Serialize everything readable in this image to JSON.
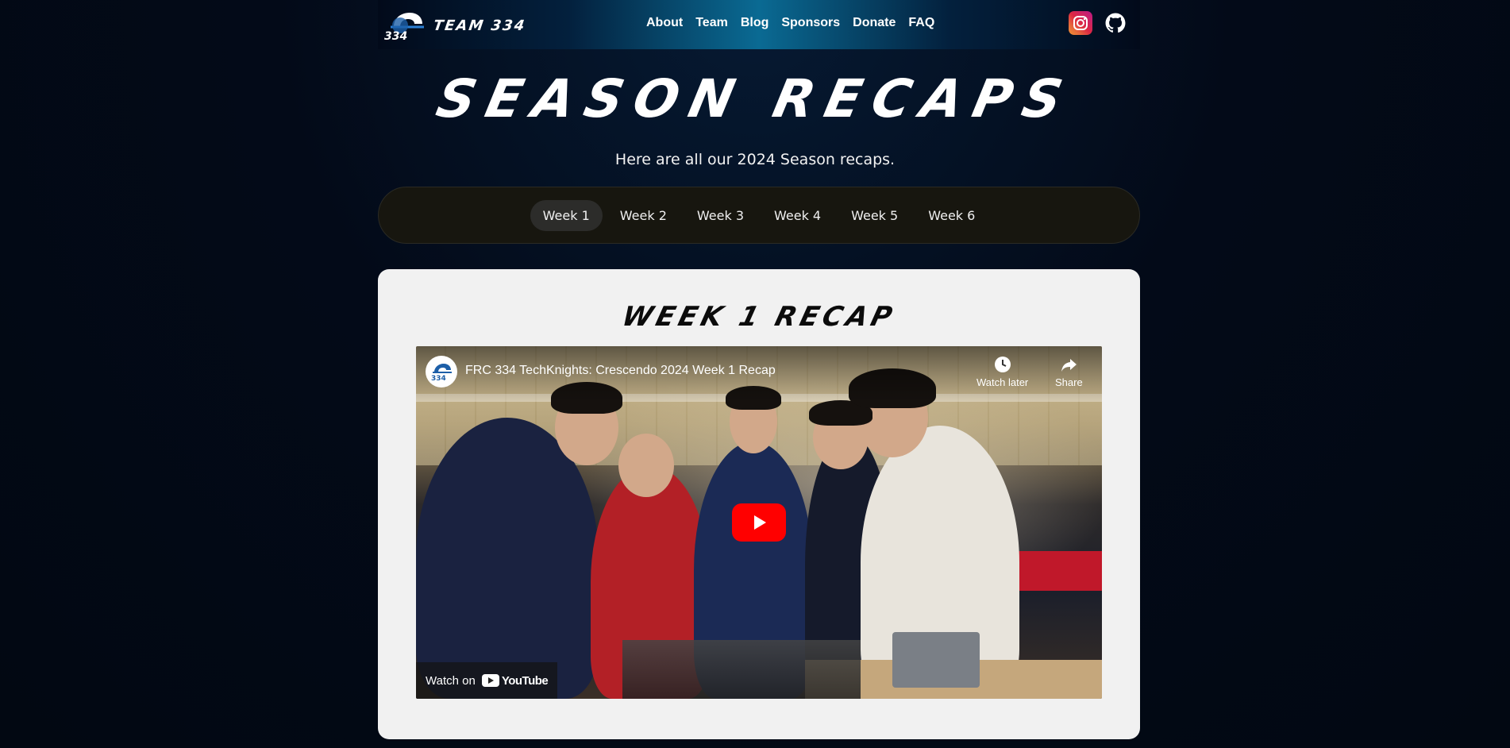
{
  "nav": {
    "brand_text": "TEAM 334",
    "links": [
      "About",
      "Team",
      "Blog",
      "Sponsors",
      "Donate",
      "FAQ"
    ],
    "icons": [
      "instagram-icon",
      "github-icon"
    ]
  },
  "hero": {
    "title": "SEASON RECAPS",
    "subtitle": "Here are all our 2024 Season recaps."
  },
  "tabs": {
    "items": [
      "Week 1",
      "Week 2",
      "Week 3",
      "Week 4",
      "Week 5",
      "Week 6"
    ],
    "active": "Week 1"
  },
  "card": {
    "title": "WEEK 1 RECAP",
    "video": {
      "title": "FRC 334 TechKnights: Crescendo 2024 Week 1 Recap",
      "watch_later": "Watch later",
      "share": "Share",
      "watch_on": "Watch on",
      "youtube": "YouTube"
    }
  },
  "colors": {
    "background": "#020812",
    "nav_accent": "#0a6a93",
    "tabs_bg": "#17160f",
    "card_bg": "#f1f1f1",
    "youtube_red": "#ff0000"
  }
}
